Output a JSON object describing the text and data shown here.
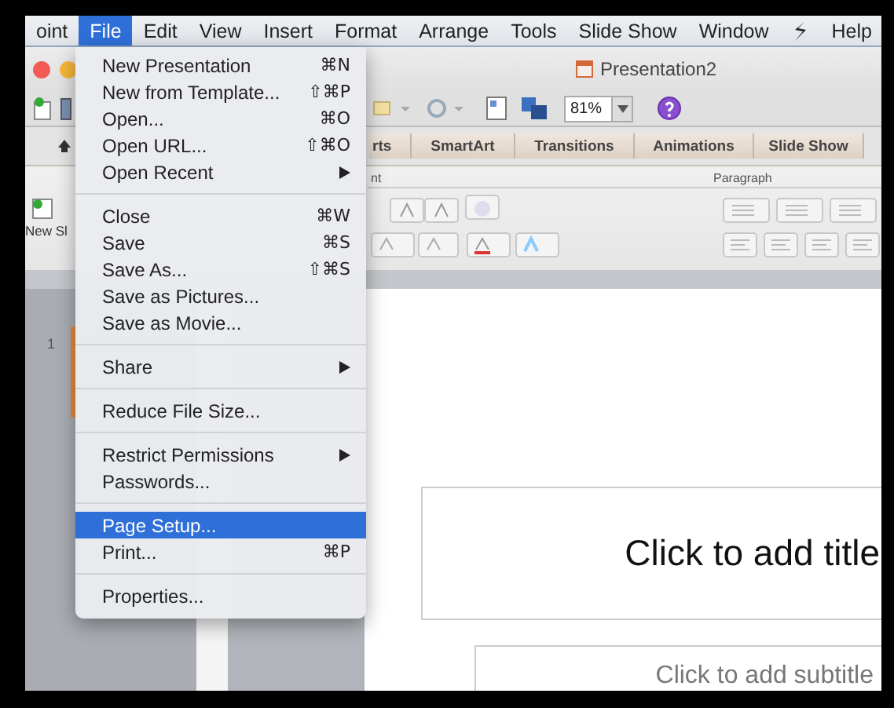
{
  "menu_bar": {
    "items": [
      {
        "kind": "text",
        "label": "oint",
        "selected": false
      },
      {
        "kind": "text",
        "label": "File",
        "selected": true
      },
      {
        "kind": "text",
        "label": "Edit",
        "selected": false
      },
      {
        "kind": "text",
        "label": "View",
        "selected": false
      },
      {
        "kind": "text",
        "label": "Insert",
        "selected": false
      },
      {
        "kind": "text",
        "label": "Format",
        "selected": false
      },
      {
        "kind": "text",
        "label": "Arrange",
        "selected": false
      },
      {
        "kind": "text",
        "label": "Tools",
        "selected": false
      },
      {
        "kind": "text",
        "label": "Slide Show",
        "selected": false
      },
      {
        "kind": "text",
        "label": "Window",
        "selected": false
      },
      {
        "kind": "script",
        "selected": false
      },
      {
        "kind": "text",
        "label": "Help",
        "selected": false
      }
    ]
  },
  "window": {
    "title": "Presentation2",
    "zoom": "81%",
    "ribbon_tabs": [
      {
        "label": "rts",
        "selected": false
      },
      {
        "label": "SmartArt",
        "selected": false
      },
      {
        "label": "Transitions",
        "selected": false
      },
      {
        "label": "Animations",
        "selected": false
      },
      {
        "label": "Slide Show",
        "selected": false
      }
    ],
    "ribbon_groups": [
      "nt",
      "Paragraph"
    ],
    "new_slide_button": "New Sl"
  },
  "slides_panel": {
    "items": [
      {
        "number": "1",
        "selected": true
      }
    ]
  },
  "slide": {
    "title_placeholder": "Click to add title",
    "subtitle_placeholder": "Click to add subtitle"
  },
  "file_menu": {
    "sections": [
      [
        {
          "label": "New Presentation",
          "shortcut": "⌘N",
          "submenu": false,
          "selected": false
        },
        {
          "label": "New from Template...",
          "shortcut": "⇧⌘P",
          "submenu": false,
          "selected": false
        },
        {
          "label": "Open...",
          "shortcut": "⌘O",
          "submenu": false,
          "selected": false
        },
        {
          "label": "Open URL...",
          "shortcut": "⇧⌘O",
          "submenu": false,
          "selected": false
        },
        {
          "label": "Open Recent",
          "submenu": true,
          "selected": false
        }
      ],
      [
        {
          "label": "Close",
          "shortcut": "⌘W",
          "submenu": false,
          "selected": false
        },
        {
          "label": "Save",
          "shortcut": "⌘S",
          "submenu": false,
          "selected": false
        },
        {
          "label": "Save As...",
          "shortcut": "⇧⌘S",
          "submenu": false,
          "selected": false
        },
        {
          "label": "Save as Pictures...",
          "submenu": false,
          "selected": false
        },
        {
          "label": "Save as Movie...",
          "submenu": false,
          "selected": false
        }
      ],
      [
        {
          "label": "Share",
          "submenu": true,
          "selected": false
        }
      ],
      [
        {
          "label": "Reduce File Size...",
          "submenu": false,
          "selected": false
        }
      ],
      [
        {
          "label": "Restrict Permissions",
          "submenu": true,
          "selected": false
        },
        {
          "label": "Passwords...",
          "submenu": false,
          "selected": false
        }
      ],
      [
        {
          "label": "Page Setup...",
          "submenu": false,
          "selected": true
        },
        {
          "label": "Print...",
          "shortcut": "⌘P",
          "submenu": false,
          "selected": false
        }
      ],
      [
        {
          "label": "Properties...",
          "submenu": false,
          "selected": false
        }
      ]
    ]
  }
}
